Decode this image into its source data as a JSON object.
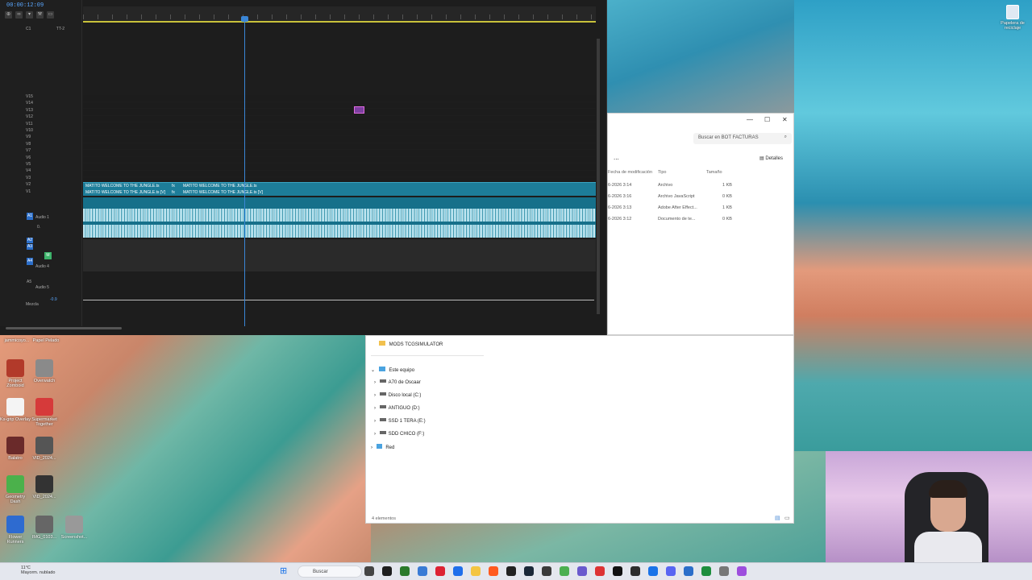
{
  "premiere": {
    "timecode": "00:00:12:09",
    "sequence_track": "C1",
    "tt_label": "TT-2",
    "video_tracks": [
      "V15",
      "V14",
      "V13",
      "V12",
      "V11",
      "V10",
      "V9",
      "V8",
      "V7",
      "V6",
      "V5",
      "V4",
      "V3",
      "V2",
      "V1"
    ],
    "video_selected_label": "V1",
    "clips": {
      "v2_a": "MATITO WELCOME TO THE JUNGLE.ts",
      "v2_b": "MATITO WELCOME TO THE JUNGLE.ts",
      "v1_a": "MATITO WELCOME TO THE JUNGLE.ts [V]",
      "v1_b": "MATITO WELCOME TO THE JUNGLE.ts [V]",
      "fx": "fx"
    },
    "audio_tracks": {
      "a1": "A1",
      "a1_name": "Audio 1",
      "a1_level": "0.",
      "a2": "A2",
      "a3": "A3",
      "a4": "A4",
      "a4_name": "Audio 4",
      "a4_m": "M",
      "a5": "A5",
      "a5_name": "Audio 5"
    },
    "mix_label": "Mezcla",
    "mix_value": "-0.9"
  },
  "explorer": {
    "search_placeholder": "Buscar en BOT FACTURAS",
    "more": "...",
    "details": "Detalles",
    "columns": {
      "date": "Fecha de modificación",
      "type": "Tipo",
      "size": "Tamaño"
    },
    "rows": [
      {
        "date": "6-2026 3:14",
        "type": "Archivo",
        "size": "1 KB"
      },
      {
        "date": "6-2026 3:16",
        "type": "Archivo JavaScript",
        "size": "0 KB"
      },
      {
        "date": "6-2026 3:13",
        "type": "Adobe After Effect...",
        "size": "1 KB"
      },
      {
        "date": "6-2026 3:12",
        "type": "Documento de te...",
        "size": "0 KB"
      }
    ],
    "folder": "MODS TCGSIMULATOR",
    "this_pc": "Este equipo",
    "drives": [
      "A70 de Oscaar",
      "Disco local (C:)",
      "ANTIGUO (D:)",
      "SSD 1 TERA (E:)",
      "SDD CHICO (F:)"
    ],
    "network": "Red",
    "status": "4 elementos"
  },
  "desktop": {
    "recycle_bin": "Papelera de reciclaje",
    "icons": [
      {
        "label": "Project Zomboid",
        "color": "#b23a2a"
      },
      {
        "label": "Overwatch",
        "color": "#8a8a8a"
      },
      {
        "label": "Ks-grip Overlay",
        "color": "#f4f4f4"
      },
      {
        "label": "Supermarket Together",
        "color": "#d63a3a"
      },
      {
        "label": "Balatro",
        "color": "#6a2a2a"
      },
      {
        "label": "VID_2024...",
        "color": "#555"
      },
      {
        "label": "Geometry Dash",
        "color": "#4bb14b"
      },
      {
        "label": "VID_2024...",
        "color": "#333"
      },
      {
        "label": "Flower Runners",
        "color": "#2e6bd0"
      },
      {
        "label": "IMG_0103...",
        "color": "#666"
      },
      {
        "label": "Screenshot...",
        "color": "#999"
      }
    ],
    "top_labels": [
      "jammicoyo...",
      "Papel Pelado"
    ]
  },
  "taskbar": {
    "temp": "11°C",
    "weather": "Mayorm. nublado",
    "search": "Buscar",
    "app_colors": [
      "#444",
      "#1e1e1e",
      "#2b7a2b",
      "#3a7bd5",
      "#d23",
      "#1f6feb",
      "#f4c542",
      "#ff5a1f",
      "#222",
      "#1b2838",
      "#3a3a3a",
      "#4caf50",
      "#6a5acd",
      "#d33",
      "#111",
      "#2d2d2d",
      "#1a73e8",
      "#5865f2",
      "#2b6ec9",
      "#1e8e3e",
      "#777",
      "#9d4edd"
    ]
  }
}
